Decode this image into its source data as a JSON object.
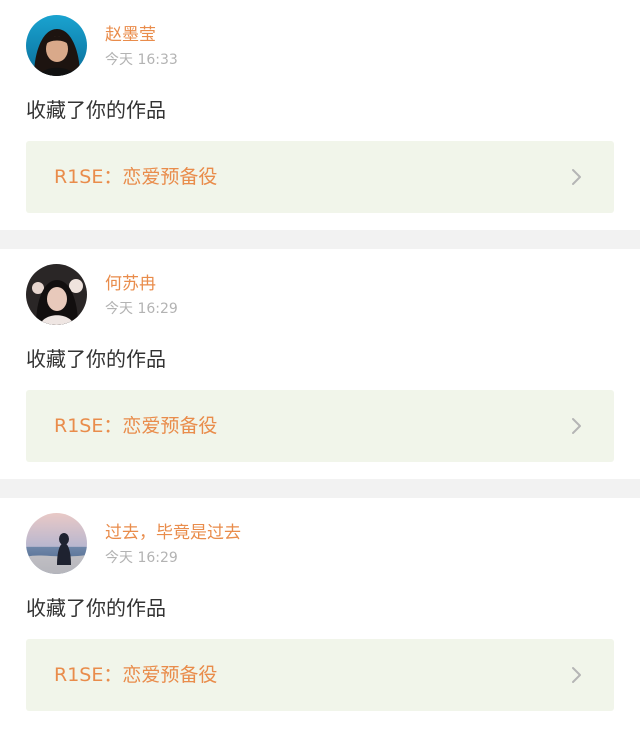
{
  "items": [
    {
      "username": "赵墨莹",
      "time": "今天 16:33",
      "action": "收藏了你的作品",
      "work_title": "R1SE：恋爱预备役",
      "avatar_icon": "avatar-girl-icon",
      "chevron_icon": "chevron-right-icon"
    },
    {
      "username": "何苏冉",
      "time": "今天 16:29",
      "action": "收藏了你的作品",
      "work_title": "R1SE：恋爱预备役",
      "avatar_icon": "avatar-woman-icon",
      "chevron_icon": "chevron-right-icon"
    },
    {
      "username": "过去，毕竟是过去",
      "time": "今天 16:29",
      "action": "收藏了你的作品",
      "work_title": "R1SE：恋爱预备役",
      "avatar_icon": "avatar-beach-icon",
      "chevron_icon": "chevron-right-icon"
    }
  ],
  "colors": {
    "accent": "#e98c4b",
    "card_bg": "#f1f5ea",
    "separator": "#f2f2f2",
    "muted": "#b3b3b3",
    "text": "#333333"
  }
}
